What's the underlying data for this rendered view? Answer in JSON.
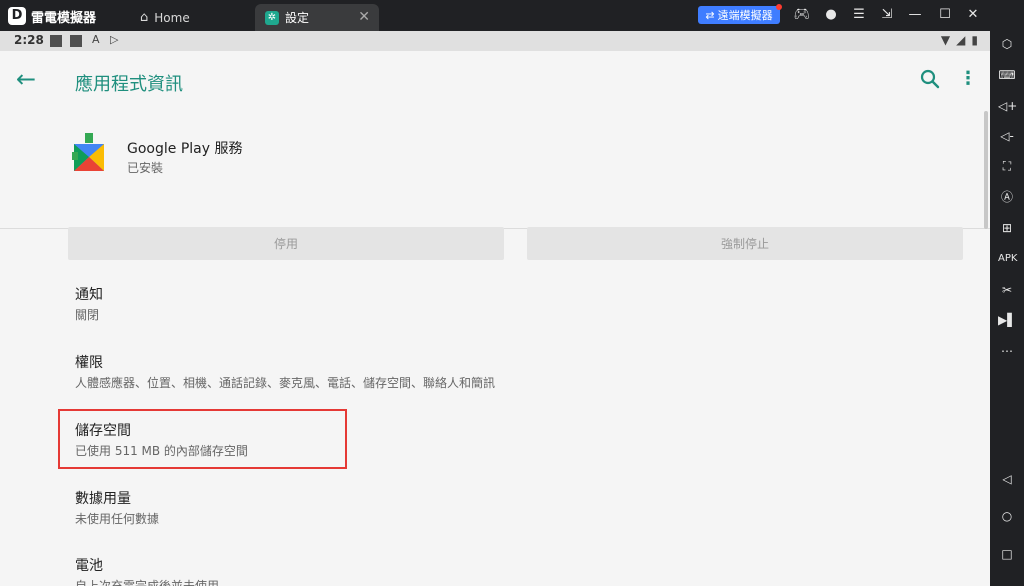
{
  "emulator": {
    "brand": "雷電模擬器",
    "tabs": [
      {
        "label": "Home"
      },
      {
        "label": "設定"
      }
    ],
    "remote_button": "遠端模擬器",
    "window_controls": [
      "gamepad-icon",
      "account-icon",
      "menu-icon",
      "resize-icon",
      "minimize-icon",
      "maximize-icon",
      "close-icon",
      "collapse-icon"
    ]
  },
  "statusbar": {
    "time": "2:28"
  },
  "appbar": {
    "title": "應用程式資訊"
  },
  "app": {
    "name": "Google Play 服務",
    "status": "已安裝"
  },
  "buttons": {
    "disable": "停用",
    "force_stop": "強制停止"
  },
  "items": [
    {
      "title": "通知",
      "subtitle": "關閉"
    },
    {
      "title": "權限",
      "subtitle": "人體感應器、位置、相機、通話記錄、麥克風、電話、儲存空間、聯絡人和簡訊"
    },
    {
      "title": "儲存空間",
      "subtitle": "已使用 511 MB 的內部儲存空間"
    },
    {
      "title": "數據用量",
      "subtitle": "未使用任何數據"
    },
    {
      "title": "電池",
      "subtitle": "自上次充電完成後並未使用"
    }
  ]
}
